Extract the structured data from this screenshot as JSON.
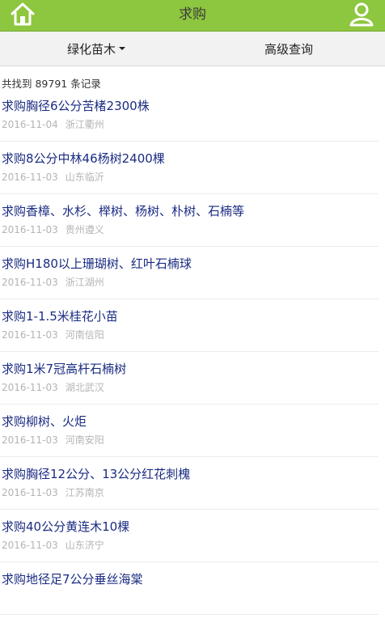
{
  "header": {
    "title": "求购"
  },
  "filters": {
    "category_label": "绿化苗木",
    "advanced_label": "高级查询"
  },
  "results": {
    "count_text": "共找到 89791 条记录"
  },
  "items": [
    {
      "title": "求购胸径6公分苦楮2300株",
      "date": "2016-11-04",
      "location": "浙江衢州"
    },
    {
      "title": "求购8公分中林46杨树2400棵",
      "date": "2016-11-03",
      "location": "山东临沂"
    },
    {
      "title": "求购香樟、水杉、榉树、杨树、朴树、石楠等",
      "date": "2016-11-03",
      "location": "贵州遵义"
    },
    {
      "title": "求购H180以上珊瑚树、红叶石楠球",
      "date": "2016-11-03",
      "location": "浙江湖州"
    },
    {
      "title": "求购1-1.5米桂花小苗",
      "date": "2016-11-03",
      "location": "河南信阳"
    },
    {
      "title": "求购1米7冠高杆石楠树",
      "date": "2016-11-03",
      "location": "湖北武汉"
    },
    {
      "title": "求购柳树、火炬",
      "date": "2016-11-03",
      "location": "河南安阳"
    },
    {
      "title": "求购胸径12公分、13公分红花刺槐",
      "date": "2016-11-03",
      "location": "江苏南京"
    },
    {
      "title": "求购40公分黄连木10棵",
      "date": "2016-11-03",
      "location": "山东济宁"
    },
    {
      "title": "求购地径足7公分垂丝海棠"
    }
  ]
}
